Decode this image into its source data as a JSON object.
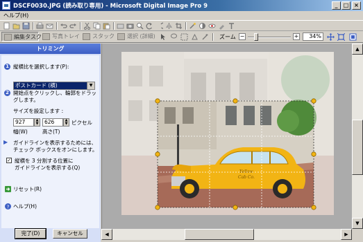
{
  "window": {
    "title": "DSCF0030.JPG (読み取り専用) - Microsoft Digital Image Pro 9",
    "minimize": "_",
    "maximize": "□",
    "close": "×"
  },
  "menu": {
    "help": "ヘルプ(H)"
  },
  "toolbar2": {
    "tabs": [
      "編集タスク",
      "写真トレイ",
      "スタック",
      "選択 (詳細)"
    ],
    "zoom_label": "ズーム",
    "zoom_minus": "−",
    "zoom_plus": "+",
    "zoom_value": "34%",
    "zoom_level_percent": 34
  },
  "panel": {
    "title": "トリミング",
    "step1_num": "1",
    "step1_text": "縦横比を選択します(P):",
    "aspect_select": "ポストカード (横)",
    "step2_num": "2",
    "step2_text_line1": "開始点をクリックし、輪郭をドラッ",
    "step2_text_line2": "グします。",
    "size_label": "サイズを設定します :",
    "width_value": "927",
    "height_value": "626",
    "unit": "ピクセル",
    "width_label": "幅(W)",
    "height_label": "高さ(T)",
    "guide_text_line1": "ガイドラインを表示するためには、",
    "guide_text_line2": "チェック ボックスをオンにします。",
    "guide_check_line1": "縦横を 3 分割する位置に",
    "guide_check_line2": "ガイドラインを表示する(Q)",
    "guide_checked": true,
    "reset": "リセット(R)",
    "help": "ヘルプ(H)",
    "done": "完了(D)",
    "cancel": "キャンセル"
  },
  "photo": {
    "taxi_text_line1": "Yellow",
    "taxi_text_line2": "Cab Co."
  }
}
